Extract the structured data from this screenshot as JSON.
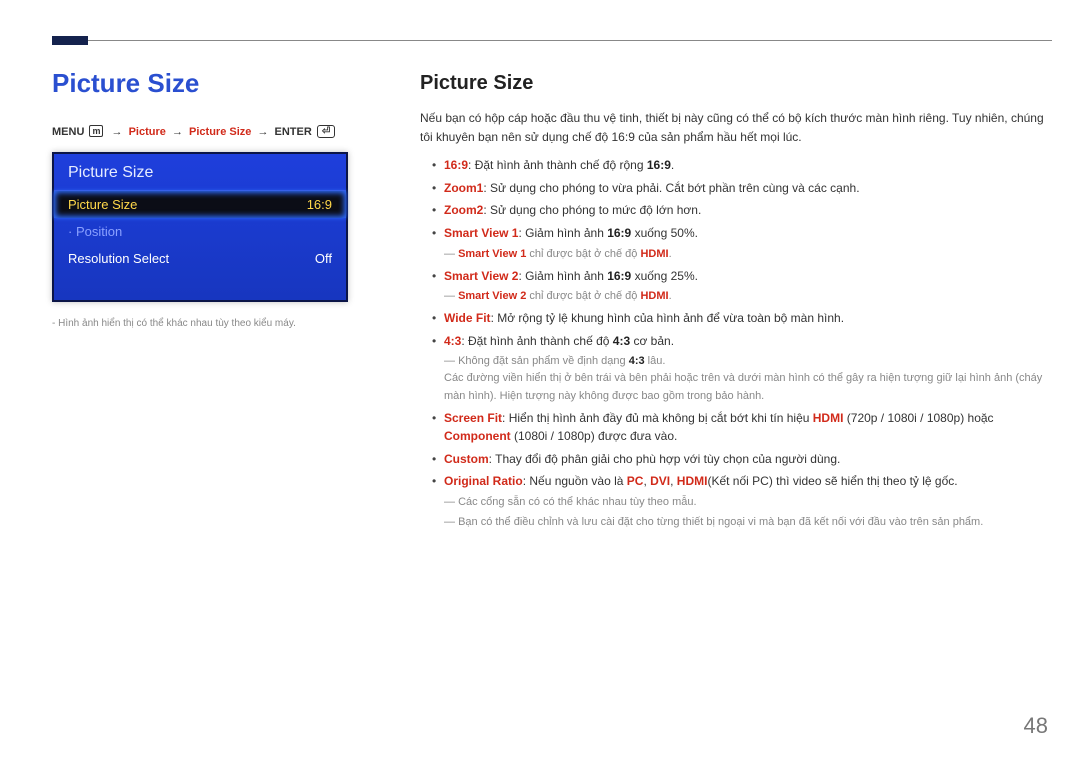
{
  "pageNumber": "48",
  "left": {
    "heading": "Picture Size",
    "breadcrumb": {
      "menu": "MENU",
      "path1": "Picture",
      "path2": "Picture Size",
      "enter": "ENTER"
    },
    "osd": {
      "title": "Picture Size",
      "rowHighlight": {
        "label": "Picture Size",
        "value": "16:9"
      },
      "rowPosition": {
        "label": "· Position"
      },
      "rowResSel": {
        "label": "Resolution Select",
        "value": "Off"
      }
    },
    "footnote": "Hình ảnh hiển thị có thể khác nhau tùy theo kiểu máy."
  },
  "right": {
    "heading": "Picture Size",
    "intro": "Nếu bạn có hộp cáp hoặc đầu thu vệ tinh, thiết bị này cũng có thể có bộ kích thước màn hình riêng. Tuy nhiên, chúng tôi khuyên bạn nên sử dụng chế độ 16:9 của sản phẩm hầu hết mọi lúc.",
    "opts": {
      "o1": {
        "term": "16:9",
        "rest": ": Đặt hình ảnh thành chế độ rộng ",
        "tail_b": "16:9",
        "tail_dot": "."
      },
      "o2": {
        "term": "Zoom1",
        "rest": ": Sử dụng cho phóng to vừa phải. Cắt bớt phần trên cùng và các cạnh."
      },
      "o3": {
        "term": "Zoom2",
        "rest": ": Sử dụng cho phóng to mức độ lớn hơn."
      },
      "o4": {
        "term": "Smart View 1",
        "rest": ": Giảm hình ảnh ",
        "b": "16:9",
        "rest2": " xuống 50%.",
        "sub_pre": "Smart View 1",
        "sub_mid": " chỉ được bật ở chế độ ",
        "sub_b": "HDMI",
        "sub_dot": "."
      },
      "o5": {
        "term": "Smart View 2",
        "rest": ": Giảm hình ảnh ",
        "b": "16:9",
        "rest2": " xuống 25%.",
        "sub_pre": "Smart View 2",
        "sub_mid": " chỉ được bật ở chế độ ",
        "sub_b": "HDMI",
        "sub_dot": "."
      },
      "o6": {
        "term": "Wide Fit",
        "rest": ": Mở rộng tỷ lệ khung hình của hình ảnh để vừa toàn bộ màn hình."
      },
      "o7": {
        "term": "4:3",
        "rest": ": Đặt hình ảnh thành chế độ ",
        "b": "4:3",
        "rest2": " cơ bản.",
        "sub1_pre": "Không đặt sản phẩm về định dạng ",
        "sub1_b": "4:3",
        "sub1_rest": " lâu.",
        "sub1_line2": "Các đường viền hiển thị ở bên trái và bên phải hoặc trên và dưới màn hình có thể gây ra hiện tượng giữ lại hình ảnh (cháy màn hình). Hiện tượng này không được bao gồm trong bảo hành."
      },
      "o8": {
        "term": "Screen Fit",
        "rest": ": Hiển thị hình ảnh đầy đủ mà không bị cắt bớt khi tín hiệu ",
        "b1": "HDMI",
        "mid1": " (720p / 1080i / 1080p) hoặc ",
        "b2": "Component",
        "mid2": " (1080i / 1080p) được đưa vào."
      },
      "o9": {
        "term": "Custom",
        "rest": ": Thay đổi độ phân giải cho phù hợp với tùy chọn của người dùng."
      },
      "o10": {
        "term": "Original Ratio",
        "rest": ": Nếu nguồn vào là ",
        "b1": "PC",
        "c1": ", ",
        "b2": "DVI",
        "c2": ", ",
        "b3": "HDMI",
        "mid": "(Kết nối PC) thì video sẽ hiển thị theo tỷ lệ gốc.",
        "sub1": "Các cổng sẵn có có thể khác nhau tùy theo mẫu.",
        "sub2": "Bạn có thể điều chỉnh và lưu cài đặt cho từng thiết bị ngoại vi mà bạn đã kết nối với đầu vào trên sản phẩm."
      }
    }
  }
}
